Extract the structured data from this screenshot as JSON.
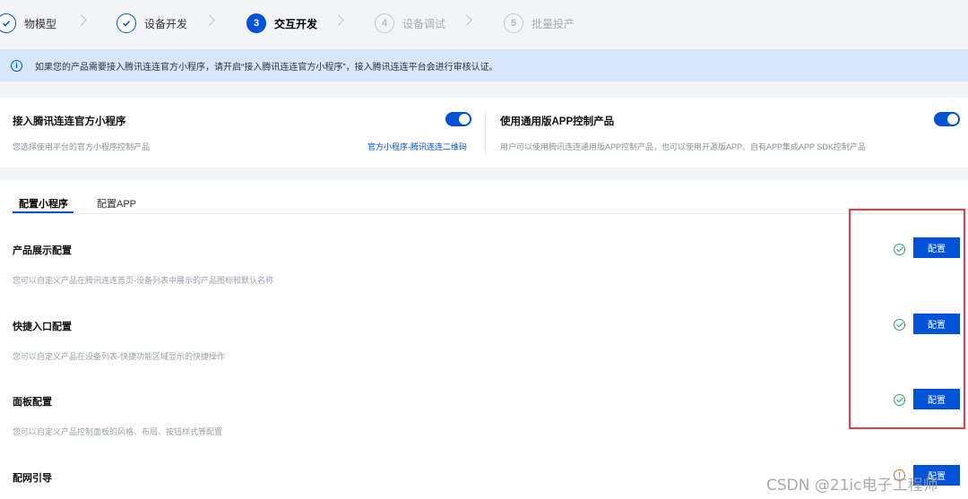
{
  "stepper": {
    "steps": [
      {
        "num": "",
        "label": "物模型",
        "state": "done"
      },
      {
        "num": "",
        "label": "设备开发",
        "state": "done"
      },
      {
        "num": "3",
        "label": "交互开发",
        "state": "active"
      },
      {
        "num": "4",
        "label": "设备调试",
        "state": "todo"
      },
      {
        "num": "5",
        "label": "批量投产",
        "state": "todo"
      }
    ]
  },
  "banner": {
    "icon": "info-icon",
    "text": "如果您的产品需要接入腾讯连连官方小程序，请开启“接入腾讯连连官方小程序”，接入腾讯连连平台会进行审核认证。"
  },
  "modes": {
    "miniprogram": {
      "title": "接入腾讯连连官方小程序",
      "desc": "您选择使用平台的官方小程序控制产品",
      "link": "官方小程序-腾讯连连二维码",
      "enabled": true
    },
    "app": {
      "title": "使用通用版APP控制产品",
      "desc": "用户可以使用腾讯连连通用版APP控制产品，也可以使用开源版APP、自有APP集成APP SDK控制产品",
      "enabled": true
    }
  },
  "tabs": [
    {
      "label": "配置小程序",
      "active": true
    },
    {
      "label": "配置APP",
      "active": false
    }
  ],
  "sections": [
    {
      "title": "产品展示配置",
      "desc": "您可以自定义产品在腾讯连连首页-设备列表中展示的产品图标和默认名称",
      "status": "check",
      "button": "配置"
    },
    {
      "title": "快捷入口配置",
      "desc": "您可以自定义产品在设备列表-快捷功能区域显示的快捷操作",
      "status": "check",
      "button": "配置"
    },
    {
      "title": "面板配置",
      "desc": "您可以自定义产品控制面板的风格、布局、按钮样式等配置",
      "status": "check",
      "button": "配置"
    },
    {
      "title": "配网引导",
      "desc": "",
      "status": "warn",
      "button": "配置"
    }
  ],
  "watermark": "CSDN @21ic电子工程师",
  "colors": {
    "primary": "#0052d9",
    "success": "#2ba471",
    "warning": "#e37318",
    "highlight": "#e83a40",
    "banner_bg": "#d7e6fb"
  }
}
